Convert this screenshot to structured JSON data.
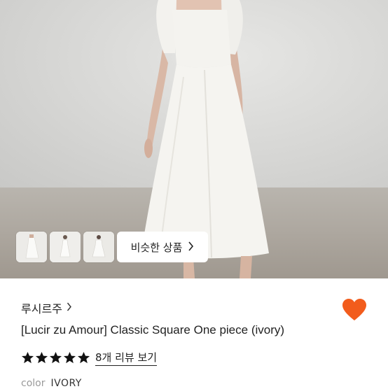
{
  "hero": {
    "thumbnails": [
      "thumbnail-1",
      "thumbnail-2",
      "thumbnail-3"
    ],
    "similar_button_label": "비슷한 상품",
    "similar_button_icon": "chevron-right-icon"
  },
  "product": {
    "brand": "루시르주",
    "brand_chevron": "›",
    "title": "[Lucir zu Amour] Classic Square One piece (ivory)",
    "liked": true,
    "heart_color": "#f25c1c",
    "rating_stars": 5,
    "review_link": "8개 리뷰 보기",
    "color_label": "color",
    "color_value": "IVORY"
  }
}
